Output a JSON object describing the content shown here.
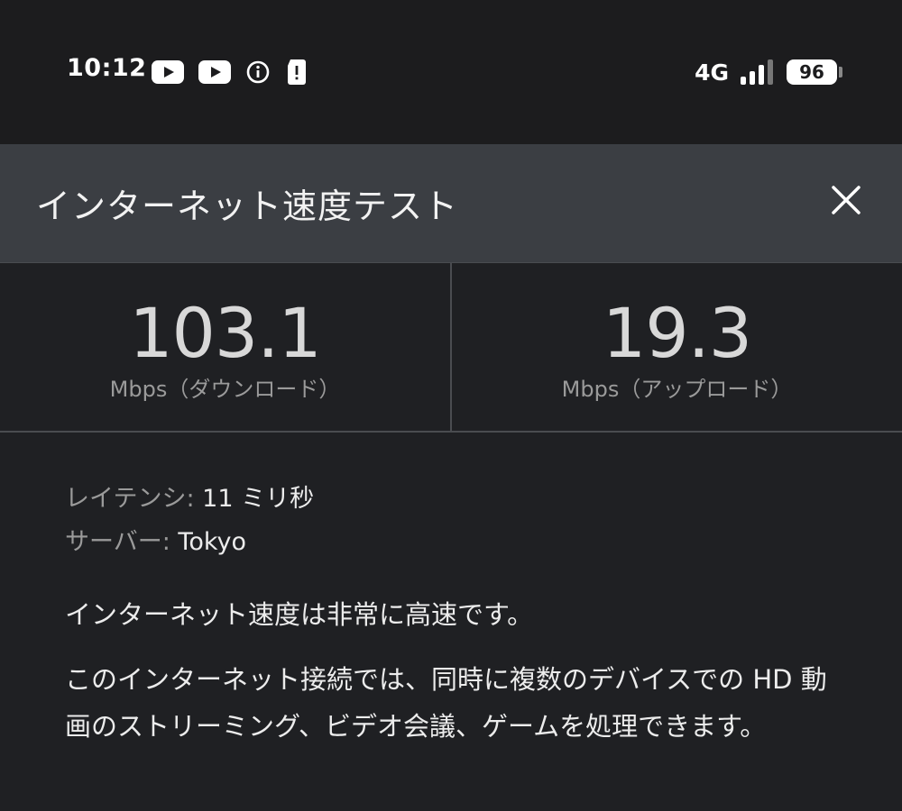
{
  "status_bar": {
    "time": "10:12",
    "network_type": "4G",
    "battery_level": "96",
    "icons_left": [
      "youtube-icon",
      "youtube-icon",
      "info-icon",
      "sim-alert-icon"
    ],
    "icons_right": [
      "signal-strength-icon",
      "battery-icon"
    ]
  },
  "dialog": {
    "title": "インターネット速度テスト",
    "close_icon": "close-icon"
  },
  "results": {
    "download": {
      "value": "103.1",
      "unit_label": "Mbps（ダウンロード）"
    },
    "upload": {
      "value": "19.3",
      "unit_label": "Mbps（アップロード）"
    }
  },
  "details": {
    "latency_label": "レイテンシ:",
    "latency_value": "11 ミリ秒",
    "server_label": "サーバー:",
    "server_value": "Tokyo"
  },
  "summary": "インターネット速度は非常に高速です。",
  "description": "このインターネット接続では、同時に複数のデバイスでの HD 動画のストリーミング、ビデオ会議、ゲームを処理できます。",
  "colors": {
    "background": "#1f2023",
    "header": "#3b3e43",
    "status_bar": "#1c1c1e"
  }
}
